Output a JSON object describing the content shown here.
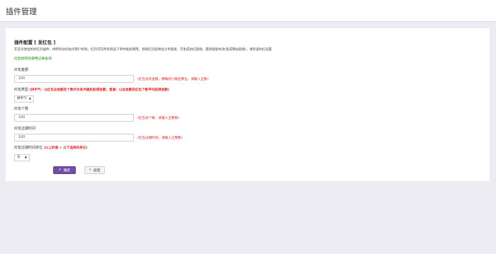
{
  "header": {
    "title": "插件管理"
  },
  "section": {
    "title": "插件配置 [ 发红包 ]",
    "description": "在首页弹出抢拆红包插件，供所有访问站点用户抢购。红包可在所有商品下单时抵扣使用。领取红包后弹出分享链接，可生成仿红链接。遇到链接失效(变成网站链接)，请检查防红设置",
    "link": "红包抢购及使用记录查询"
  },
  "fields": {
    "amount": {
      "label": "红包金额",
      "value": "100",
      "hint": "(红包总的金额，精确到小数后两位，请输入正数)"
    },
    "type": {
      "label": "红包类型",
      "note": "(拼手气：以红包总金额及个数作为条件随机取得金额；普通：以总金额及红包个数平均取得金额)",
      "selected": "拼手气"
    },
    "count": {
      "label": "红包个数",
      "value": "100",
      "hint": "(红包总个数，请输入正整数)"
    },
    "expire": {
      "label": "红包过期时间",
      "value": "100",
      "hint": "(红包过期时间，请输入正整数)"
    },
    "expire_unit": {
      "label": "红包过期时间单位",
      "note": "(以上的值 + 以下选择的单位)",
      "selected": "天"
    }
  },
  "buttons": {
    "confirm": "确定",
    "back": "返回"
  },
  "icons": {
    "confirm": "check-icon",
    "back": "back-arrow-icon"
  },
  "colors": {
    "primary": "#6f4fa3",
    "danger": "#e02424",
    "link": "#0a8a0a"
  }
}
